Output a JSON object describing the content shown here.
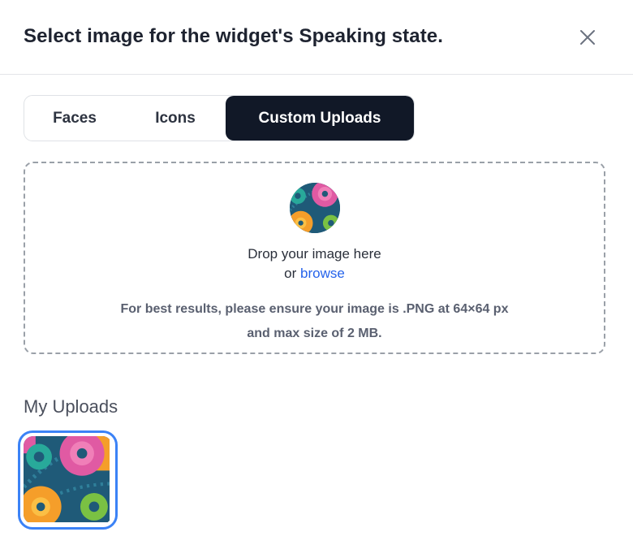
{
  "dialog": {
    "title": "Select image for the widget's Speaking state.",
    "close_icon": "close-icon"
  },
  "tabs": [
    {
      "label": "Faces",
      "active": false
    },
    {
      "label": "Icons",
      "active": false
    },
    {
      "label": "Custom Uploads",
      "active": true
    }
  ],
  "dropzone": {
    "icon": "gears-icon",
    "line1": "Drop your image here",
    "line2_prefix": "or ",
    "browse_label": "browse",
    "hint_line1": "For best results, please ensure your image is .PNG at 64×64 px",
    "hint_line2": "and max size of 2 MB."
  },
  "my_uploads": {
    "title": "My Uploads",
    "items": [
      {
        "icon": "gears-image",
        "selected": true
      }
    ]
  },
  "colors": {
    "active_tab_bg": "#111827",
    "link": "#2563eb",
    "selected_border": "#3b82f6"
  }
}
